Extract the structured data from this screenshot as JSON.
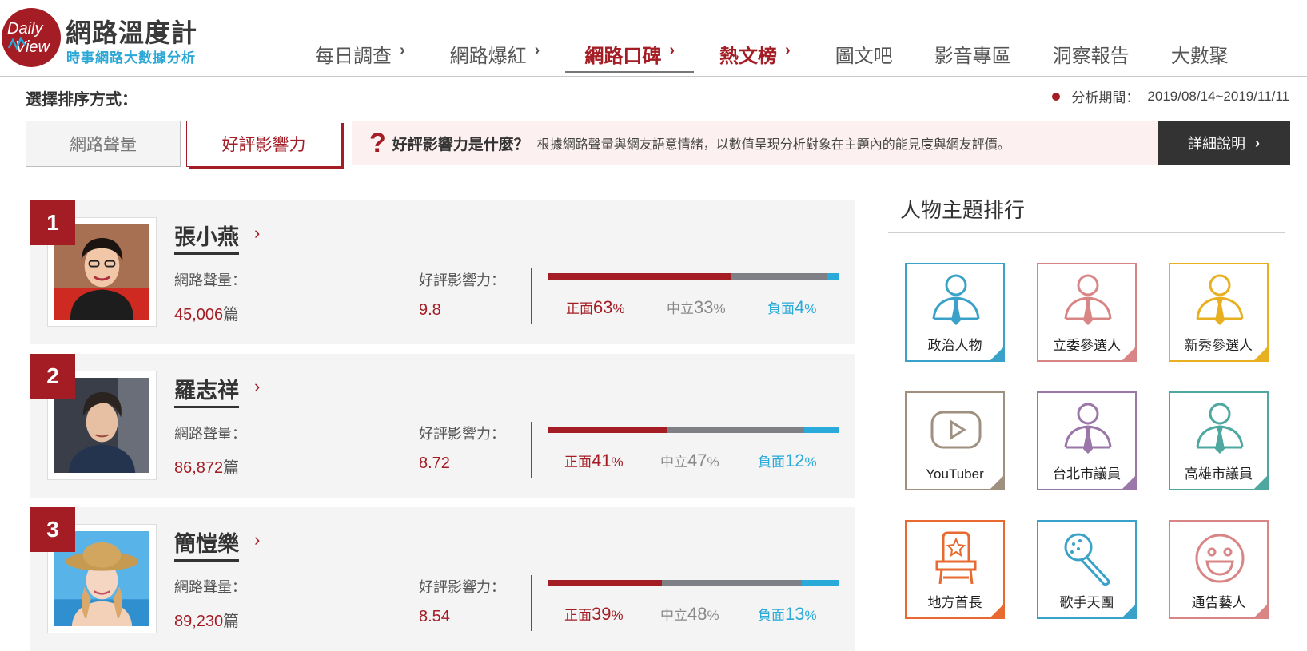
{
  "brand": {
    "logo_line1": "Daily",
    "logo_line2": "View",
    "title": "網路溫度計",
    "subtitle": "時事網路大數據分析"
  },
  "nav": [
    {
      "label": "每日調查",
      "chevron": "›"
    },
    {
      "label": "網路爆紅",
      "chevron": "›"
    },
    {
      "label": "網路口碑",
      "chevron": "›",
      "active": true
    },
    {
      "label": "熱文榜",
      "chevron": "›"
    },
    {
      "label": "圖文吧",
      "chevron": ""
    },
    {
      "label": "影音專區",
      "chevron": ""
    },
    {
      "label": "洞察報告",
      "chevron": ""
    },
    {
      "label": "大數聚",
      "chevron": ""
    }
  ],
  "sort": {
    "label": "選擇排序方式：",
    "period_label": "分析期間：",
    "period_value": "2019/08/14~2019/11/11",
    "option_volume": "網路聲量",
    "option_influence": "好評影響力"
  },
  "info": {
    "question_mark": "?",
    "title": "好評影響力是什麼？",
    "description": "根據網路聲量與網友語意情緒，以數值呈現分析對象在主題內的能見度與網友評價。",
    "detail_button": "詳細說明",
    "detail_chevron": "›"
  },
  "ranking_labels": {
    "volume": "網路聲量：",
    "influence": "好評影響力：",
    "positive": "正面",
    "neutral": "中立",
    "negative": "負面",
    "unit": "篇",
    "percent": "%",
    "name_chevron": "›"
  },
  "ranking": [
    {
      "rank": "1",
      "name": "張小燕",
      "volume": "45,006",
      "influence": "9.8",
      "positive": 63,
      "neutral": 33,
      "negative": 4,
      "positive_text": "63",
      "neutral_text": "33",
      "negative_text": "4"
    },
    {
      "rank": "2",
      "name": "羅志祥",
      "volume": "86,872",
      "influence": "8.72",
      "positive": 41,
      "neutral": 47,
      "negative": 12,
      "positive_text": "41",
      "neutral_text": "47",
      "negative_text": "12"
    },
    {
      "rank": "3",
      "name": "簡愷樂",
      "volume": "89,230",
      "influence": "8.54",
      "positive": 39,
      "neutral": 48,
      "negative": 13,
      "positive_text": "39",
      "neutral_text": "48",
      "negative_text": "13"
    }
  ],
  "sidebar": {
    "title": "人物主題排行",
    "tiles": [
      {
        "label": "政治人物",
        "icon": "person-icon",
        "color": "#3aa2c8"
      },
      {
        "label": "立委參選人",
        "icon": "person-icon",
        "color": "#d98585"
      },
      {
        "label": "新秀參選人",
        "icon": "person-icon",
        "color": "#e8b020"
      },
      {
        "label": "YouTuber",
        "icon": "play-icon",
        "color": "#a09080"
      },
      {
        "label": "台北市議員",
        "icon": "person-icon",
        "color": "#9a77a8"
      },
      {
        "label": "高雄市議員",
        "icon": "person-icon",
        "color": "#4fa8a0"
      },
      {
        "label": "地方首長",
        "icon": "chair-icon",
        "color": "#e86a30"
      },
      {
        "label": "歌手天團",
        "icon": "microphone-icon",
        "color": "#3aa2c8"
      },
      {
        "label": "通告藝人",
        "icon": "smiley-icon",
        "color": "#d98585"
      }
    ]
  },
  "colors": {
    "brand_red": "#a41c24",
    "accent_blue": "#29aad8",
    "neutral_gray": "#7f7f86"
  }
}
